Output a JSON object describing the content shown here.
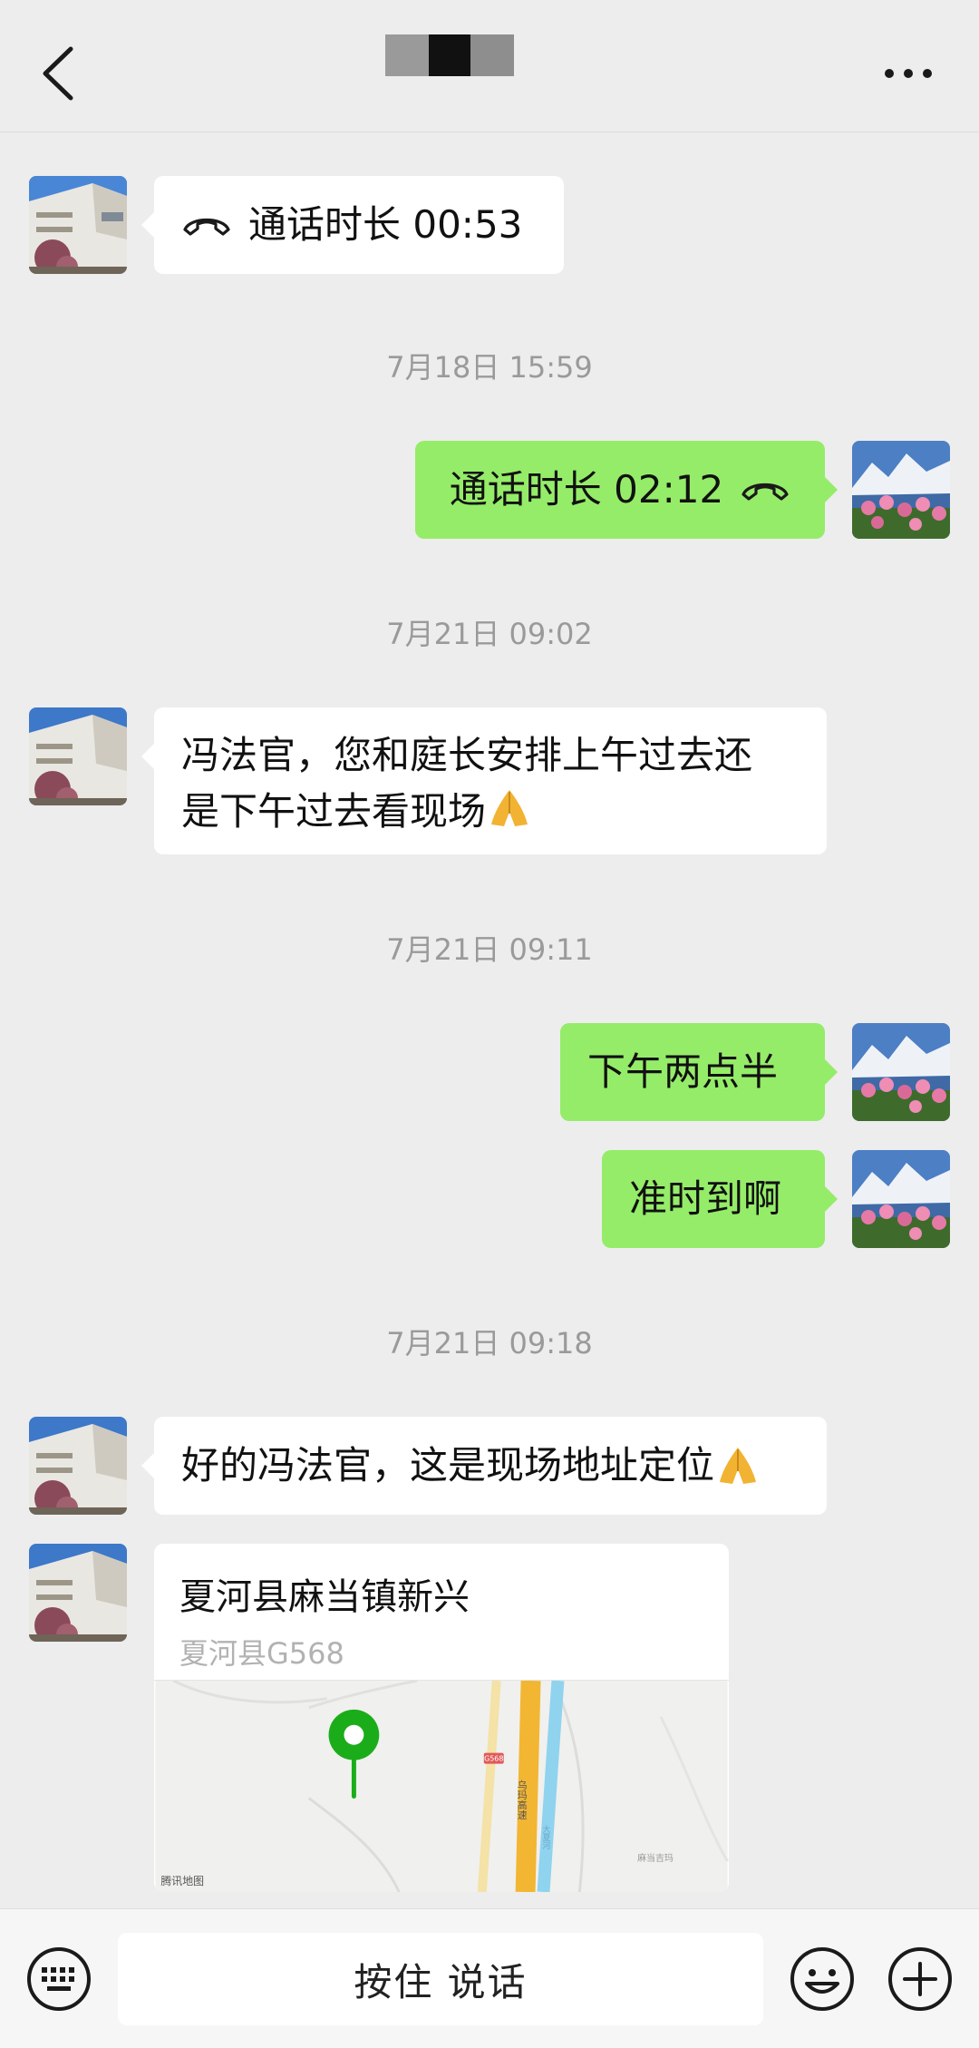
{
  "header": {
    "title_redacted": true
  },
  "messages": [
    {
      "id": "m1",
      "side": "in",
      "type": "call",
      "text": "通话时长 00:53"
    },
    {
      "id": "t1",
      "type": "timestamp",
      "text": "7月18日 15:59"
    },
    {
      "id": "m2",
      "side": "out",
      "type": "call",
      "text": "通话时长 02:12"
    },
    {
      "id": "t2",
      "type": "timestamp",
      "text": "7月21日 09:02"
    },
    {
      "id": "m3",
      "side": "in",
      "type": "text",
      "line1": "冯法官，您和庭长安排上午过去还",
      "line2": "是下午过去看现场"
    },
    {
      "id": "t3",
      "type": "timestamp",
      "text": "7月21日 09:11"
    },
    {
      "id": "m4",
      "side": "out",
      "type": "text",
      "text": "下午两点半"
    },
    {
      "id": "m5",
      "side": "out",
      "type": "text",
      "text": "准时到啊"
    },
    {
      "id": "t4",
      "type": "timestamp",
      "text": "7月21日 09:18"
    },
    {
      "id": "m6",
      "side": "in",
      "type": "text",
      "text": "好的冯法官，这是现场地址定位"
    },
    {
      "id": "m7",
      "side": "in",
      "type": "location",
      "title": "夏河县麻当镇新兴",
      "subtitle": "夏河县G568",
      "map_labels": {
        "road_badge": "G568",
        "highway": "乌玛高速",
        "river": "大夏河",
        "village": "麻当吉玛",
        "provider": "腾讯地图"
      }
    }
  ],
  "input": {
    "voice_label": "按住 说话"
  },
  "colors": {
    "background": "#ededed",
    "outgoing_bubble": "#95ec69",
    "incoming_bubble": "#ffffff",
    "map_pin": "#1aad19"
  }
}
